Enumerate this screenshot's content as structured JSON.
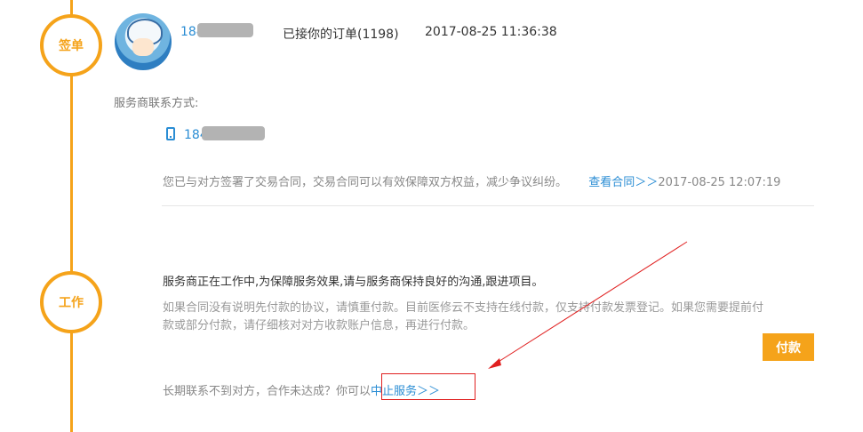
{
  "steps": {
    "sign": {
      "label": "签单"
    },
    "work": {
      "label": "工作"
    }
  },
  "order": {
    "user_phone_prefix": "184",
    "status_text": "已接你的订单(1198)",
    "timestamp": "2017-08-25 11:36:38"
  },
  "provider": {
    "contact_label": "服务商联系方式:",
    "phone_prefix": "184"
  },
  "contract": {
    "notice": "您已与对方签署了交易合同，交易合同可以有效保障双方权益，减少争议纠纷。",
    "view_link": "查看合同＞＞",
    "timestamp": "2017-08-25 12:07:19"
  },
  "work": {
    "headline": "服务商正在工作中,为保障服务效果,请与服务商保持良好的沟通,跟进项目。",
    "note_line1": "如果合同没有说明先付款的协议，请慎重付款。目前医修云不支持在线付款，仅支持付款发票登记。如果您需要提前付",
    "note_line2": "款或部分付款，请仔细核对对方收款账户信息，再进行付款。",
    "pay_button": "付款",
    "stop_prompt": "长期联系不到对方，合作未达成？你可以",
    "stop_link": "中止服务＞＞"
  },
  "colors": {
    "accent": "#f5a31a",
    "link": "#2a8dd4",
    "annotation": "#e02020"
  }
}
